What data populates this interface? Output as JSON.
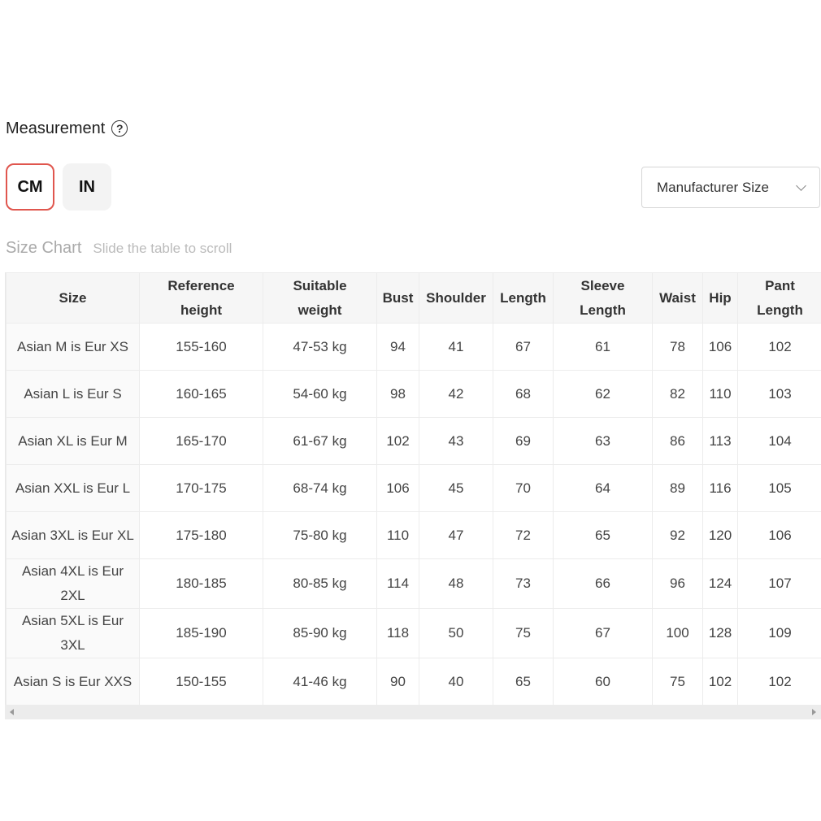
{
  "measurement": {
    "title": "Measurement",
    "help_icon": "question-circle-icon"
  },
  "units": {
    "cm_label": "CM",
    "in_label": "IN",
    "selected": "CM"
  },
  "size_select": {
    "value": "Manufacturer Size",
    "icon": "chevron-down-icon"
  },
  "size_chart": {
    "title": "Size Chart",
    "hint": "Slide the table to scroll"
  },
  "colors": {
    "active_border": "#e0564e",
    "header_bg": "#f6f6f6"
  },
  "table": {
    "headers": [
      [
        "Size"
      ],
      [
        "Reference",
        "height"
      ],
      [
        "Suitable",
        "weight"
      ],
      [
        "Bust"
      ],
      [
        "Shoulder"
      ],
      [
        "Length"
      ],
      [
        "Sleeve",
        "Length"
      ],
      [
        "Waist"
      ],
      [
        "Hip"
      ],
      [
        "Pant",
        "Length"
      ]
    ],
    "rows": [
      [
        [
          "Asian M is Eur XS"
        ],
        "155-160",
        "47-53 kg",
        "94",
        "41",
        "67",
        "61",
        "78",
        "106",
        "102"
      ],
      [
        [
          "Asian L is Eur S"
        ],
        "160-165",
        "54-60 kg",
        "98",
        "42",
        "68",
        "62",
        "82",
        "110",
        "103"
      ],
      [
        [
          "Asian XL is Eur M"
        ],
        "165-170",
        "61-67 kg",
        "102",
        "43",
        "69",
        "63",
        "86",
        "113",
        "104"
      ],
      [
        [
          "Asian XXL is Eur L"
        ],
        "170-175",
        "68-74 kg",
        "106",
        "45",
        "70",
        "64",
        "89",
        "116",
        "105"
      ],
      [
        [
          "Asian 3XL is Eur XL"
        ],
        "175-180",
        "75-80 kg",
        "110",
        "47",
        "72",
        "65",
        "92",
        "120",
        "106"
      ],
      [
        [
          "Asian 4XL is Eur",
          "2XL"
        ],
        "180-185",
        "80-85 kg",
        "114",
        "48",
        "73",
        "66",
        "96",
        "124",
        "107"
      ],
      [
        [
          "Asian 5XL is Eur",
          "3XL"
        ],
        "185-190",
        "85-90 kg",
        "118",
        "50",
        "75",
        "67",
        "100",
        "128",
        "109"
      ],
      [
        [
          "Asian S is Eur XXS"
        ],
        "150-155",
        "41-46 kg",
        "90",
        "40",
        "65",
        "60",
        "75",
        "102",
        "102"
      ]
    ]
  }
}
